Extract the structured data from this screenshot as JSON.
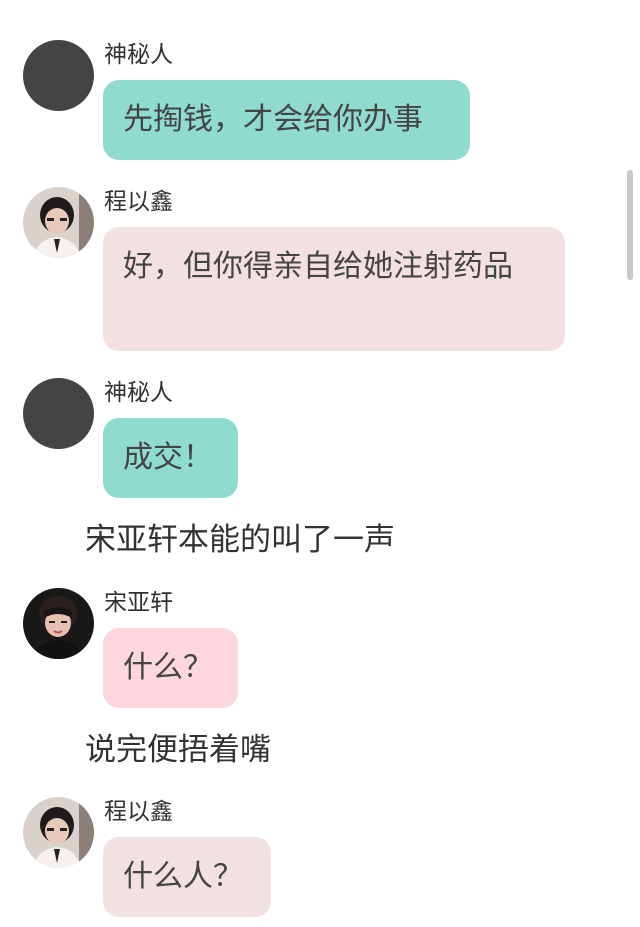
{
  "colors": {
    "teal": "#8fdccf",
    "pink_pale": "#f3e0e1",
    "pink": "#fdd6de",
    "dark_avatar": "#444444"
  },
  "messages": [
    {
      "speaker": "神秘人",
      "text": "先掏钱，才会给你办事",
      "avatar": "dark-circle-icon"
    },
    {
      "speaker": "程以鑫",
      "text": "好，但你得亲自给她注射药品",
      "avatar": "person-photo-icon"
    },
    {
      "speaker": "神秘人",
      "text": "成交！",
      "avatar": "dark-circle-icon"
    },
    {
      "narration": "宋亚轩本能的叫了一声"
    },
    {
      "speaker": "宋亚轩",
      "text": "什么？",
      "avatar": "person-photo-icon"
    },
    {
      "narration": "说完便捂着嘴"
    },
    {
      "speaker": "程以鑫",
      "text": "什么人？",
      "avatar": "person-photo-icon"
    }
  ]
}
